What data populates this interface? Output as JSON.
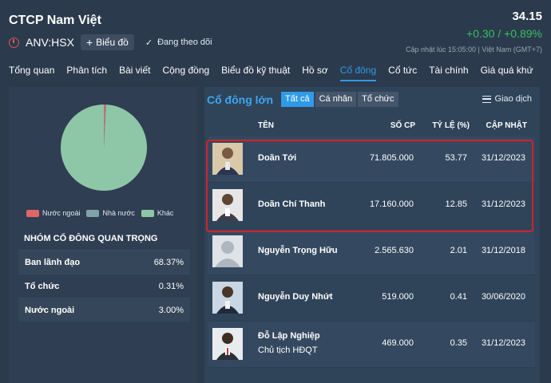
{
  "header": {
    "company_name": "CTCP Nam Việt",
    "ticker": "ANV:HSX",
    "chart_button": "Biểu đồ",
    "follow_label": "Đang theo dõi",
    "price": "34.15",
    "change": "+0.30 / +0.89%",
    "updated": "Cập nhật lúc 15:05:00 | Việt Nam (GMT+7)"
  },
  "tabs": [
    {
      "label": "Tổng quan"
    },
    {
      "label": "Phân tích"
    },
    {
      "label": "Bài viết"
    },
    {
      "label": "Cộng đồng"
    },
    {
      "label": "Biểu đồ kỹ thuật"
    },
    {
      "label": "Hồ sơ"
    },
    {
      "label": "Cổ đông"
    },
    {
      "label": "Cổ tức"
    },
    {
      "label": "Tài chính"
    },
    {
      "label": "Giá quá khứ"
    }
  ],
  "active_tab": "Cổ đông",
  "pie": {
    "slices": [
      {
        "name": "Nước ngoài",
        "value": 0.6,
        "color": "#e06666"
      },
      {
        "name": "Nhà nước",
        "value": 0.3,
        "color": "#7fa3a9"
      },
      {
        "name": "Khác",
        "value": 99.1,
        "color": "#8ec7a8"
      }
    ]
  },
  "legend": [
    {
      "label": "Nước ngoài",
      "color": "#e06666"
    },
    {
      "label": "Nhà nước",
      "color": "#7fa3a9"
    },
    {
      "label": "Khác",
      "color": "#8ec7a8"
    }
  ],
  "groups": {
    "title": "NHÓM CỔ ĐÔNG QUAN TRỌNG",
    "rows": [
      {
        "name": "Ban lãnh đạo",
        "value": "68.37%"
      },
      {
        "name": "Tổ chức",
        "value": "0.31%"
      },
      {
        "name": "Nước ngoài",
        "value": "3.00%"
      }
    ]
  },
  "shareholders": {
    "title": "Cổ đông lớn",
    "filters": [
      "Tất cả",
      "Cá nhân",
      "Tổ chức"
    ],
    "active_filter": "Tất cả",
    "trade_label": "Giao dịch",
    "columns": {
      "name": "TÊN",
      "shares": "SỐ CP",
      "ratio": "TỶ LỆ (%)",
      "updated": "CẬP NHẬT"
    },
    "rows": [
      {
        "name": "Doãn Tới",
        "subtitle": "",
        "shares": "71.805.000",
        "ratio": "53.77",
        "date": "31/12/2023",
        "avatar": "photo"
      },
      {
        "name": "Doãn Chí Thanh",
        "subtitle": "",
        "shares": "17.160.000",
        "ratio": "12.85",
        "date": "31/12/2023",
        "avatar": "photo"
      },
      {
        "name": "Nguyễn Trọng Hữu",
        "subtitle": "",
        "shares": "2.565.630",
        "ratio": "2.01",
        "date": "31/12/2018",
        "avatar": "placeholder"
      },
      {
        "name": "Nguyễn Duy Nhứt",
        "subtitle": "",
        "shares": "519.000",
        "ratio": "0.41",
        "date": "30/06/2020",
        "avatar": "photo"
      },
      {
        "name": "Đỗ Lập Nghiệp",
        "subtitle": "Chủ tịch HĐQT",
        "shares": "469.000",
        "ratio": "0.35",
        "date": "31/12/2023",
        "avatar": "photo"
      }
    ]
  }
}
